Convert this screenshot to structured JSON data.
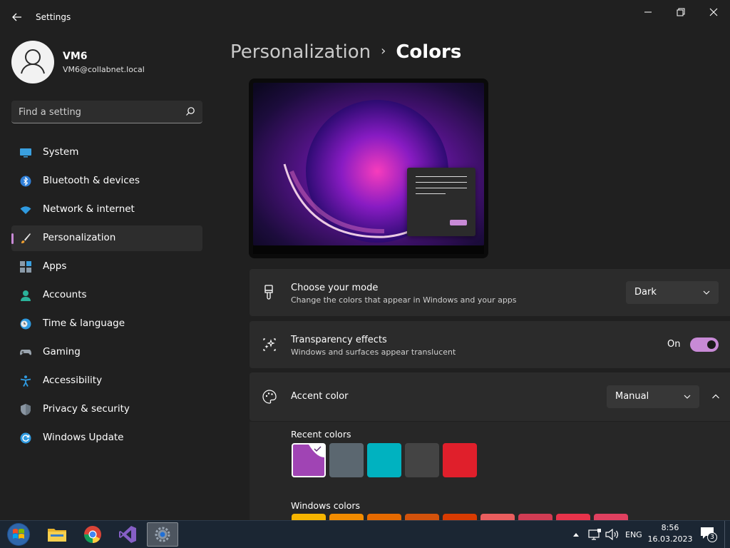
{
  "app": {
    "title": "Settings"
  },
  "profile": {
    "name": "VM6",
    "email": "VM6@collabnet.local"
  },
  "search": {
    "placeholder": "Find a setting"
  },
  "nav": {
    "items": [
      {
        "label": "System",
        "icon": "monitor-icon",
        "active": false
      },
      {
        "label": "Bluetooth & devices",
        "icon": "bluetooth-icon",
        "active": false
      },
      {
        "label": "Network & internet",
        "icon": "wifi-icon",
        "active": false
      },
      {
        "label": "Personalization",
        "icon": "brush-icon",
        "active": true
      },
      {
        "label": "Apps",
        "icon": "apps-icon",
        "active": false
      },
      {
        "label": "Accounts",
        "icon": "person-icon",
        "active": false
      },
      {
        "label": "Time & language",
        "icon": "clock-globe-icon",
        "active": false
      },
      {
        "label": "Gaming",
        "icon": "gamepad-icon",
        "active": false
      },
      {
        "label": "Accessibility",
        "icon": "accessibility-icon",
        "active": false
      },
      {
        "label": "Privacy & security",
        "icon": "shield-icon",
        "active": false
      },
      {
        "label": "Windows Update",
        "icon": "update-icon",
        "active": false
      }
    ]
  },
  "breadcrumb": {
    "parent": "Personalization",
    "separator": "›",
    "current": "Colors"
  },
  "mode": {
    "title": "Choose your mode",
    "description": "Change the colors that appear in Windows and your apps",
    "value": "Dark"
  },
  "transparency": {
    "title": "Transparency effects",
    "description": "Windows and surfaces appear translucent",
    "state_label": "On",
    "on": true
  },
  "accent": {
    "title": "Accent color",
    "value": "Manual",
    "expanded": true
  },
  "recent_colors": {
    "label": "Recent colors",
    "swatches": [
      "#a044b4",
      "#5b6770",
      "#00b2c0",
      "#444444",
      "#e01f2b"
    ],
    "selected_index": 0
  },
  "windows_colors": {
    "label": "Windows colors",
    "swatches": [
      "#f7b500",
      "#f28c00",
      "#e66a00",
      "#d3520b",
      "#d83b01",
      "#ea5e5e",
      "#d13c53",
      "#e8334a",
      "#e0405f"
    ]
  },
  "taskbar": {
    "apps": [
      "start-orb-icon",
      "file-explorer-icon",
      "chrome-icon",
      "visual-studio-icon",
      "settings-app-icon"
    ],
    "language": "ENG",
    "time": "8:56",
    "date": "16.03.2023",
    "notification_count": "3"
  },
  "colors": {
    "accent": "#c88ad6",
    "background": "#202020",
    "card": "#2b2b2b"
  }
}
